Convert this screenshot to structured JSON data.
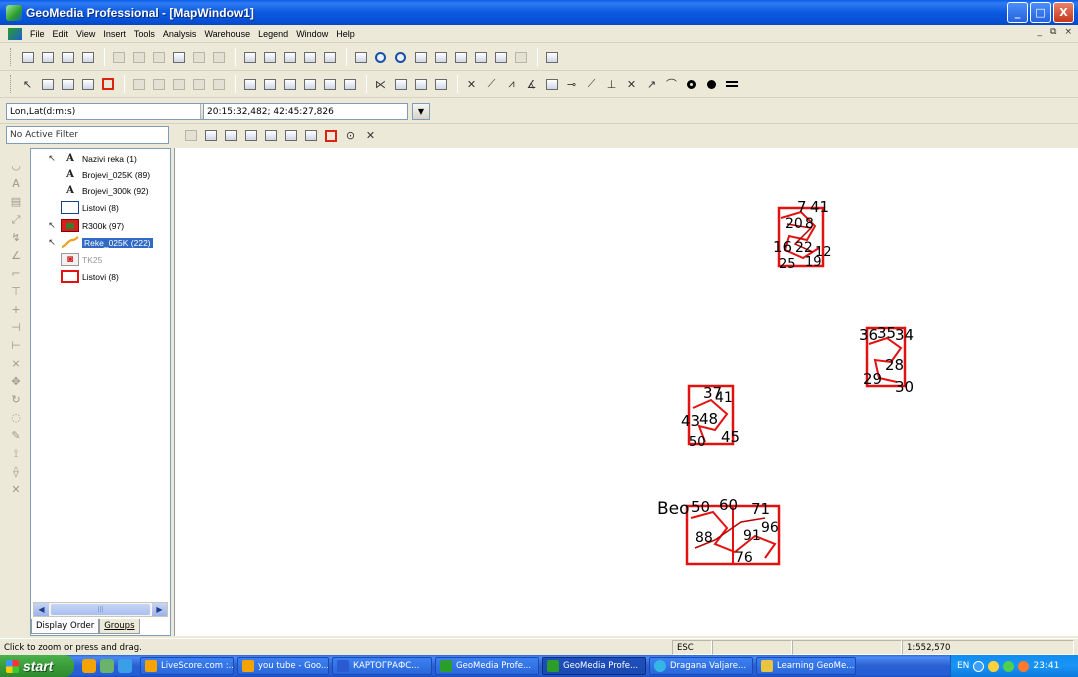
{
  "window": {
    "title": "GeoMedia Professional - [MapWindow1]",
    "buttons": [
      "_",
      "□",
      "X"
    ]
  },
  "menubar": {
    "items": [
      "File",
      "Edit",
      "View",
      "Insert",
      "Tools",
      "Analysis",
      "Warehouse",
      "Legend",
      "Window",
      "Help"
    ],
    "mdi_buttons": [
      "_",
      "⧉",
      "×"
    ]
  },
  "coordinates": {
    "system_value": "Lon,Lat(d:m:s)",
    "readout": "20:15:32,482; 42:45:27,826"
  },
  "filter": {
    "value": "No Active Filter"
  },
  "legend": {
    "entries": [
      {
        "label": "Nazivi reka (1)",
        "swatch": "text-A",
        "pointer": true
      },
      {
        "label": "Brojevi_025K (89)",
        "swatch": "text-A",
        "pointer": false
      },
      {
        "label": "Brojevi_300k (92)",
        "swatch": "text-A",
        "pointer": false
      },
      {
        "label": "Listovi (8)",
        "swatch": "blue-rect",
        "pointer": false
      },
      {
        "label": "R300k (97)",
        "swatch": "raster",
        "pointer": true
      },
      {
        "label": "Reke_025K (222)",
        "swatch": "river-line",
        "pointer": true,
        "selected": true
      },
      {
        "label": "TK25",
        "swatch": "tk-raster",
        "pointer": false,
        "dim": true
      },
      {
        "label": "Listovi (8)",
        "swatch": "red-rect",
        "pointer": false
      }
    ],
    "tabs": [
      "Display Order",
      "Groups"
    ]
  },
  "map": {
    "clusters": [
      {
        "labels": [
          "7",
          "41",
          "20",
          "8",
          "16",
          "22",
          "25",
          "19",
          "12"
        ],
        "color": "#e41111"
      },
      {
        "labels": [
          "36",
          "35",
          "34",
          "28",
          "29",
          "30"
        ],
        "color": "#e41111"
      },
      {
        "labels": [
          "37",
          "41",
          "43",
          "48",
          "45",
          "50"
        ],
        "color": "#e41111"
      },
      {
        "labels": [
          "Beo",
          "50",
          "60",
          "71",
          "88",
          "91",
          "96",
          "76"
        ],
        "color": "#e41111"
      }
    ]
  },
  "status": {
    "message": "Click to zoom or press and drag.",
    "key": "ESC",
    "scale": "1:552,570"
  },
  "taskbar": {
    "start": "start",
    "tasks": [
      {
        "label": "LiveScore.com :...",
        "icon_color": "#f5a300"
      },
      {
        "label": "you tube - Goo...",
        "icon_color": "#f5a300"
      },
      {
        "label": "КАРТОГРАФС...",
        "icon_color": "#2a5bd0"
      },
      {
        "label": "GeoMedia Profe...",
        "icon_color": "#2a9d2a"
      },
      {
        "label": "GeoMedia Profe...",
        "icon_color": "#2a9d2a",
        "active": true
      },
      {
        "label": "Dragana Valjare...",
        "icon_color": "#33b5e5"
      },
      {
        "label": "Learning GeoMe...",
        "icon_color": "#e8c440"
      }
    ],
    "tray": {
      "lang": "EN",
      "clock": "23:41"
    }
  }
}
